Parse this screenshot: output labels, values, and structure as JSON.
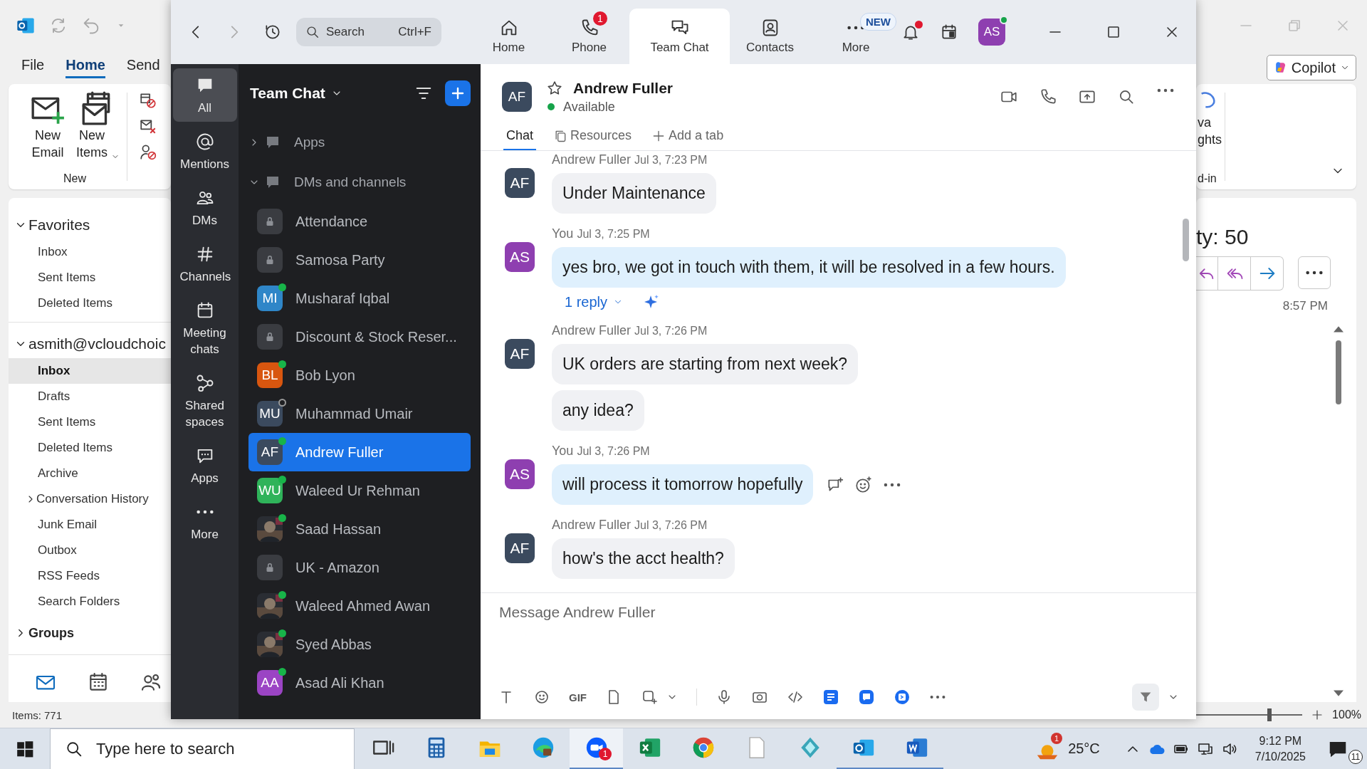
{
  "outlook": {
    "ribbon_tabs": [
      {
        "label": "File",
        "selected": false
      },
      {
        "label": "Home",
        "selected": true
      },
      {
        "label": "Send",
        "selected": false
      }
    ],
    "copilot": "Copilot",
    "ribbon_buttons": [
      {
        "label": "New Email",
        "kind": "plain"
      },
      {
        "label": "New Items",
        "kind": "dropdown"
      }
    ],
    "ribbon_group": "New",
    "ribbon_fragment": {
      "lines": [
        "va",
        "ghts"
      ],
      "group": "d-in"
    },
    "folders": [
      {
        "label": "Favorites",
        "expanded": true,
        "children": [
          {
            "label": "Inbox",
            "selected": false
          },
          {
            "label": "Sent Items",
            "selected": false
          },
          {
            "label": "Deleted Items",
            "selected": false
          }
        ]
      },
      {
        "label": "asmith@vcloudchoic",
        "expanded": true,
        "children": [
          {
            "label": "Inbox",
            "selected": true
          },
          {
            "label": "Drafts",
            "selected": false
          },
          {
            "label": "Sent Items",
            "selected": false
          },
          {
            "label": "Deleted Items",
            "selected": false
          },
          {
            "label": "Archive",
            "selected": false
          },
          {
            "label": "Conversation History",
            "selected": false,
            "expanded": false
          },
          {
            "label": "Junk Email",
            "selected": false
          },
          {
            "label": "Outbox",
            "selected": false
          },
          {
            "label": "RSS Feeds",
            "selected": false
          },
          {
            "label": "Search Folders",
            "selected": false
          }
        ]
      },
      {
        "label": "Groups",
        "expanded": false
      }
    ],
    "nav_icons": [
      {
        "selected": true
      },
      {
        "selected": false
      },
      {
        "selected": false
      }
    ],
    "reading": {
      "subject": "ty: 50",
      "time": "8:57 PM"
    },
    "status_bar": "Items: 771",
    "zoom_slider": {
      "level": 0.7
    },
    "zoom_level": "100%"
  },
  "zoom": {
    "search": {
      "placeholder": "Search",
      "shortcut": "Ctrl+F"
    },
    "tabs": [
      {
        "label": "Home",
        "selected": false
      },
      {
        "label": "Phone",
        "selected": false,
        "badge": {
          "text": "1",
          "kind": "count"
        }
      },
      {
        "label": "Team Chat",
        "selected": true
      },
      {
        "label": "Contacts",
        "selected": false
      },
      {
        "label": "More",
        "selected": false,
        "badge": {
          "text": "NEW",
          "kind": "new"
        }
      }
    ],
    "notifications_unread": true,
    "user": {
      "initials": "AS",
      "color": "#8e3fb0",
      "online": true
    },
    "rail": [
      {
        "label": "All",
        "selected": true
      },
      {
        "label": "Mentions",
        "selected": false
      },
      {
        "label": "DMs",
        "selected": false
      },
      {
        "label": "Channels",
        "selected": false
      },
      {
        "label": "Meeting chats",
        "selected": false
      },
      {
        "label": "Shared spaces",
        "selected": false
      },
      {
        "label": "Apps",
        "selected": false
      },
      {
        "label": "More",
        "selected": false
      }
    ],
    "list": {
      "title": "Team Chat",
      "sections": [
        {
          "label": "Apps",
          "expanded": false
        },
        {
          "label": "DMs and channels",
          "expanded": true,
          "children": [
            {
              "name": "Attendance",
              "kind": "channel",
              "selected": false
            },
            {
              "name": "Samosa Party",
              "kind": "channel",
              "selected": false
            },
            {
              "name": "Musharaf Iqbal",
              "kind": "person",
              "initials": "MI",
              "color": "#2f86c8",
              "online": true,
              "selected": false
            },
            {
              "name": "Discount & Stock Reser...",
              "kind": "channel",
              "selected": false
            },
            {
              "name": "Bob Lyon",
              "kind": "person",
              "initials": "BL",
              "color": "#d8560f",
              "online": true,
              "selected": false
            },
            {
              "name": "Muhammad Umair",
              "kind": "person",
              "initials": "MU",
              "color": "#3b4a5e",
              "online": false,
              "selected": false
            },
            {
              "name": "Andrew Fuller",
              "kind": "person",
              "initials": "AF",
              "color": "#3b4a5e",
              "online": true,
              "selected": true
            },
            {
              "name": "Waleed Ur Rehman",
              "kind": "person",
              "initials": "WU",
              "color": "#2fb35a",
              "online": true,
              "selected": false
            },
            {
              "name": "Saad Hassan",
              "online": true,
              "selected": false
            },
            {
              "name": "UK - Amazon",
              "kind": "channel",
              "selected": false
            },
            {
              "name": "Waleed Ahmed Awan",
              "online": true,
              "selected": false
            },
            {
              "name": "Syed Abbas",
              "online": true,
              "selected": false
            },
            {
              "name": "Asad Ali Khan",
              "kind": "person",
              "initials": "AA",
              "color": "#9b44c4",
              "online": true,
              "selected": false
            }
          ]
        }
      ]
    },
    "chat": {
      "contact": {
        "initials": "AF",
        "color": "#3b4a5e",
        "name": "Andrew Fuller",
        "status": "Available",
        "online": true,
        "starred": false
      },
      "tabs": [
        {
          "label": "Chat",
          "kind": "tab",
          "selected": true
        },
        {
          "label": "Resources",
          "kind": "tab",
          "selected": false
        },
        {
          "label": "Add a tab",
          "kind": "add",
          "selected": false
        }
      ],
      "messages": [
        {
          "sender": "Andrew Fuller",
          "time": "Jul 3, 7:23 PM",
          "initials": "AF",
          "color": "#3b4a5e",
          "mine": false,
          "hovered": false,
          "bubbles": [
            "Under Maintenance"
          ]
        },
        {
          "sender": "You",
          "time": "Jul 3, 7:25 PM",
          "initials": "AS",
          "color": "#8e3fb0",
          "mine": true,
          "hovered": false,
          "bubbles": [
            "yes bro, we got in touch with them, it will be resolved in a few hours."
          ],
          "replies": "1 reply"
        },
        {
          "sender": "Andrew Fuller",
          "time": "Jul 3, 7:26 PM",
          "initials": "AF",
          "color": "#3b4a5e",
          "mine": false,
          "hovered": false,
          "bubbles": [
            "UK orders are starting from next week?",
            "any idea?"
          ]
        },
        {
          "sender": "You",
          "time": "Jul 3, 7:26 PM",
          "initials": "AS",
          "color": "#8e3fb0",
          "mine": true,
          "hovered": true,
          "bubbles": [
            "will process it tomorrow hopefully"
          ]
        },
        {
          "sender": "Andrew Fuller",
          "time": "Jul 3, 7:26 PM",
          "initials": "AF",
          "color": "#3b4a5e",
          "mine": false,
          "hovered": false,
          "bubbles": [
            "how's the acct health?"
          ]
        }
      ],
      "composer": {
        "placeholder": "Message Andrew Fuller",
        "gif": "GIF"
      }
    }
  },
  "taskbar": {
    "search_placeholder": "Type here to search",
    "apps": [
      {
        "running": false,
        "active": false
      },
      {
        "running": false,
        "active": false
      },
      {
        "running": false,
        "active": false
      },
      {
        "running": false,
        "active": false
      },
      {
        "running": true,
        "active": true,
        "badge": "1"
      },
      {
        "running": false,
        "active": false
      },
      {
        "running": false,
        "active": false
      },
      {
        "running": false,
        "active": false
      },
      {
        "running": false,
        "active": false
      },
      {
        "running": true,
        "active": false
      },
      {
        "running": true,
        "active": false
      }
    ],
    "weather": {
      "temperature": "25°C",
      "badge": "1"
    },
    "time": "9:12 PM",
    "date": "7/10/2025",
    "notifications": "11"
  }
}
